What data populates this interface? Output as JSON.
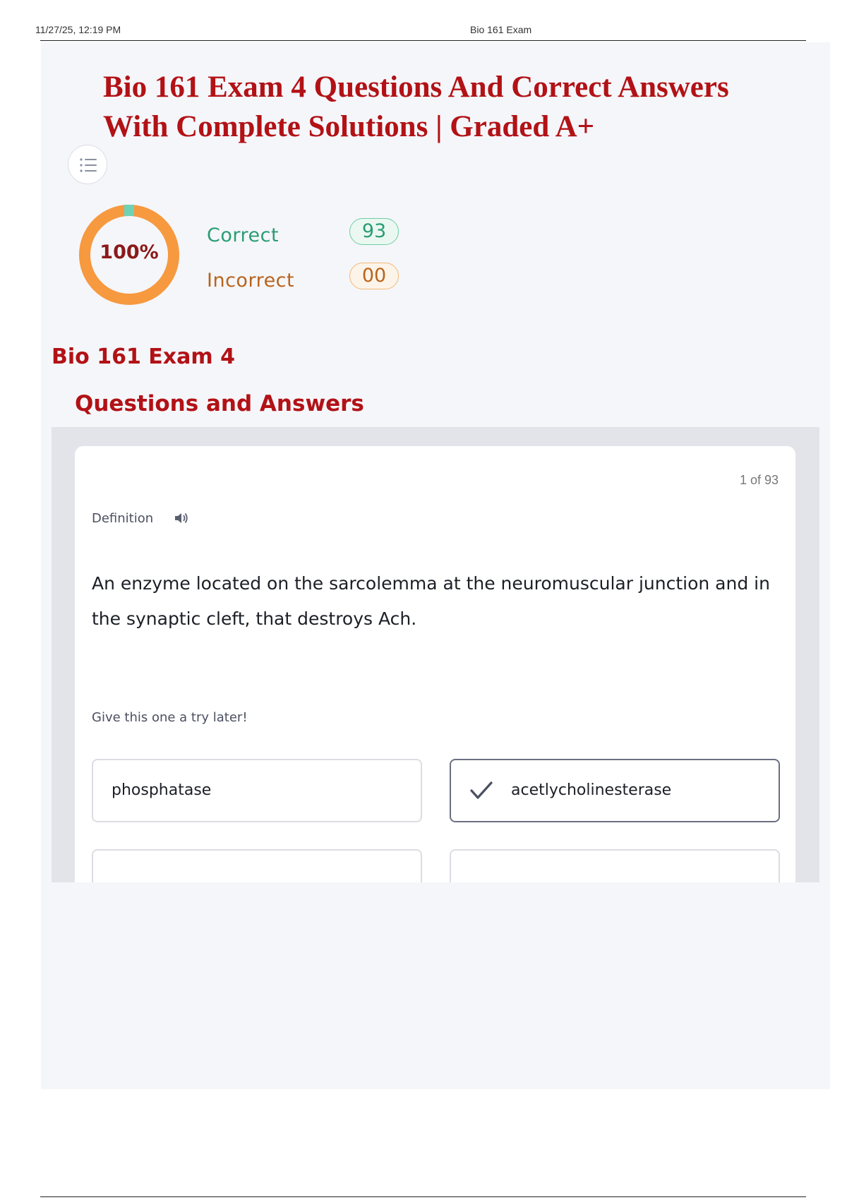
{
  "print_header": {
    "date": "11/27/25, 12:19 PM",
    "title": "Bio 161 Exam"
  },
  "document": {
    "title": "Bio 161 Exam 4 Questions And Correct Answers With Complete Solutions | Graded A+",
    "menu_icon": "list-icon"
  },
  "score": {
    "percent_label": "100%",
    "progress_fraction": 1.0,
    "correct_label": "Correct",
    "correct_count": "93",
    "incorrect_label": "Incorrect",
    "incorrect_count": "00"
  },
  "section": {
    "title": "Bio 161 Exam 4",
    "subtitle": "Questions and Answers"
  },
  "card": {
    "counter": "1 of 93",
    "term_label": "Definition",
    "audio_icon": "speaker-icon",
    "question": "An enzyme located on the sarcolemma at the neuromuscular junction and in the synaptic cleft, that destroys Ach.",
    "hint": "Give this one a try later!",
    "options": [
      {
        "label": "phosphatase",
        "selected": false
      },
      {
        "label": "acetlycholinesterase",
        "selected": true,
        "icon": "check-icon"
      },
      {
        "label": "",
        "selected": false
      },
      {
        "label": "",
        "selected": false
      }
    ]
  },
  "colors": {
    "title_red": "#b21216",
    "ring_orange": "#f6993f",
    "ring_start_teal": "#6ed3b4",
    "correct_green": "#2a9d72",
    "incorrect_orange": "#b8641d"
  }
}
